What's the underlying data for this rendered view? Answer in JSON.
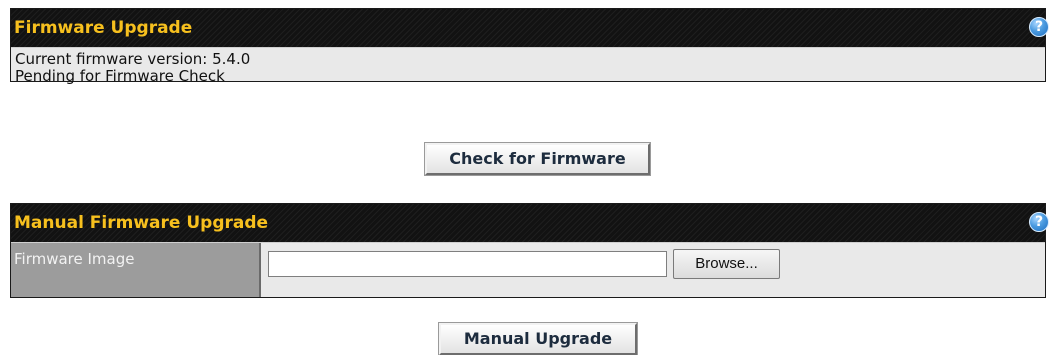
{
  "firmware_upgrade": {
    "title": "Firmware Upgrade",
    "help_icon": "?",
    "current_version_text": "Current firmware version: 5.4.0",
    "status_text": "Pending for Firmware Check",
    "check_button_label": "Check for Firmware"
  },
  "manual_upgrade": {
    "title": "Manual Firmware Upgrade",
    "help_icon": "?",
    "field_label": "Firmware Image",
    "file_value": "",
    "browse_label": "Browse...",
    "upgrade_button_label": "Manual Upgrade"
  },
  "colors": {
    "header_background": "#121212",
    "header_title": "#f7c01e",
    "body_background": "#e9e9e9",
    "label_cell_background": "#9c9c9c"
  },
  "icons": {
    "help": "help-icon"
  }
}
